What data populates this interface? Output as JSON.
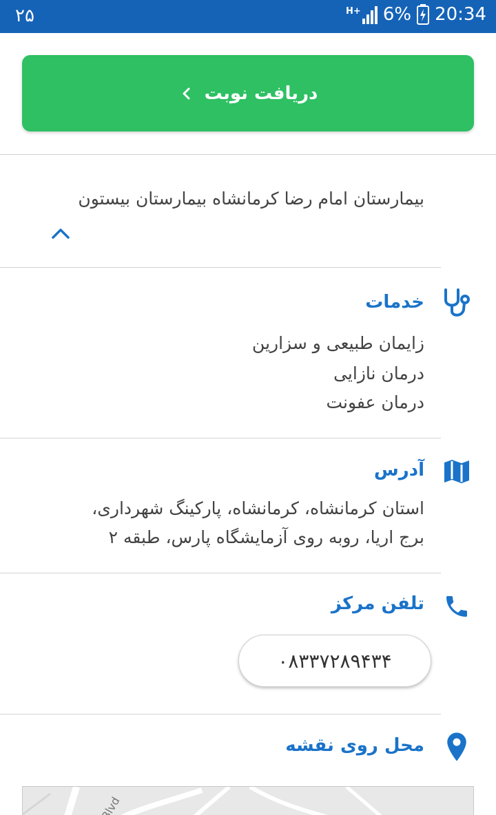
{
  "status_bar": {
    "notification": "۲۵",
    "network": "H+",
    "battery": "6%",
    "time": "20:34"
  },
  "cta": {
    "label": "دریافت نوبت"
  },
  "description": {
    "text": "بیمارستان امام رضا کرمانشاه بیمارستان بیستون"
  },
  "services": {
    "title": "خدمات",
    "items": [
      "زایمان طبیعی و سزارین",
      "درمان نازایی",
      "درمان عفونت"
    ]
  },
  "address": {
    "title": "آدرس",
    "lines": [
      "استان کرمانشاه، کرمانشاه، پارکینگ شهرداری،",
      "برج اریا، روبه روی آزمایشگاه پارس، طبقه ۲"
    ]
  },
  "phone": {
    "title": "تلفن مرکز",
    "number": "۰۸۳۳۷۲۸۹۴۳۴"
  },
  "map": {
    "title": "محل روی نقشه",
    "road_label": "Blvd"
  },
  "colors": {
    "status_bar": "#1563b7",
    "cta": "#2ec063",
    "accent": "#1a73c9"
  }
}
